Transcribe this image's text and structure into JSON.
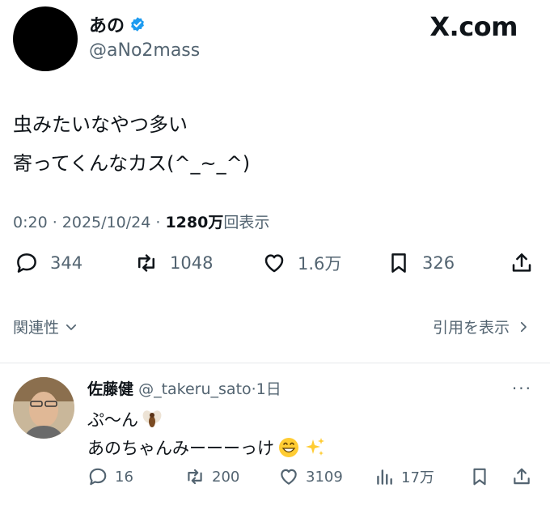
{
  "author": {
    "name": "あの",
    "handle": "@aNo2mass"
  },
  "brand": "X.com",
  "tweet": {
    "lines": [
      "虫みたいなやつ多い",
      "寄ってくんなカス(^_~_^)"
    ]
  },
  "meta": {
    "time": "0:20",
    "sep1": " · ",
    "date": "2025/10/24",
    "sep2": " · ",
    "views": "1280万",
    "views_suffix": "回表示"
  },
  "stats": {
    "replies": "344",
    "reposts": "1048",
    "likes": "1.6万",
    "bookmarks": "326"
  },
  "links": {
    "related": "関連性",
    "quotes": "引用を表示"
  },
  "reply": {
    "name": "佐藤健",
    "handle": "@_takeru_sato",
    "time": "·1日",
    "lines": [
      "ぷ〜ん",
      "あのちゃんみーーーっけ"
    ],
    "stats": {
      "replies": "16",
      "reposts": "200",
      "likes": "3109",
      "views": "17万"
    }
  },
  "colors": {
    "text": "#0f1419",
    "muted": "#536471",
    "verified": "#1d9bf0",
    "divider": "#e6e9ec"
  }
}
